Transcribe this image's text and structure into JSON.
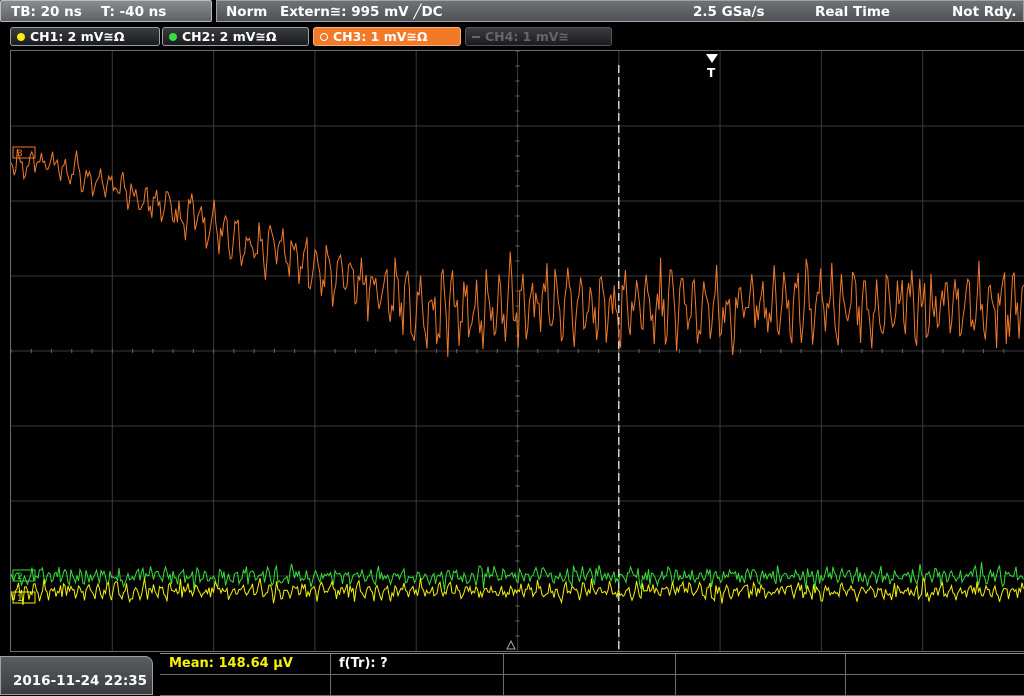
{
  "topbar": {
    "timebase": "TB: 20 ns",
    "trigger_offset": "T: -40 ns",
    "mode": "Norm",
    "trigger_source": "Extern≅: 995 mV ╱DC",
    "sample_rate": "2.5 GSa/s",
    "acq_mode": "Real Time",
    "status": "Not Rdy."
  },
  "channels": [
    {
      "label": "CH1: 2 mV≅Ω",
      "color": "#f5f10a",
      "state": "on"
    },
    {
      "label": "CH2: 2 mV≅Ω",
      "color": "#34e03a",
      "state": "on"
    },
    {
      "label": "CH3: 1 mV≅Ω",
      "color": "#f07a2a",
      "state": "active"
    },
    {
      "label": "CH4: 1 mV≅",
      "color": "#777777",
      "state": "off"
    }
  ],
  "screen": {
    "trigger_marker": "T",
    "ch3_marker": "3",
    "ch2_marker": "2",
    "ch1_marker": "1"
  },
  "waveforms": {
    "ch3": {
      "color": "#f07a2a",
      "high_level_div": -2.5,
      "low_level_div": -0.6,
      "transition_start_ns": -92,
      "transition_end_ns": -20
    },
    "ch2": {
      "color": "#34e03a",
      "level_div": 3.0
    },
    "ch1": {
      "color": "#f5f10a",
      "level_div": 3.2
    },
    "grid": {
      "h_divisions": 10,
      "v_divisions": 8
    }
  },
  "bottombar": {
    "datetime": "2016-11-24 22:35",
    "mean_label": "Mean: 148.64 µV",
    "ftr_label": "f(Tr): ?"
  }
}
